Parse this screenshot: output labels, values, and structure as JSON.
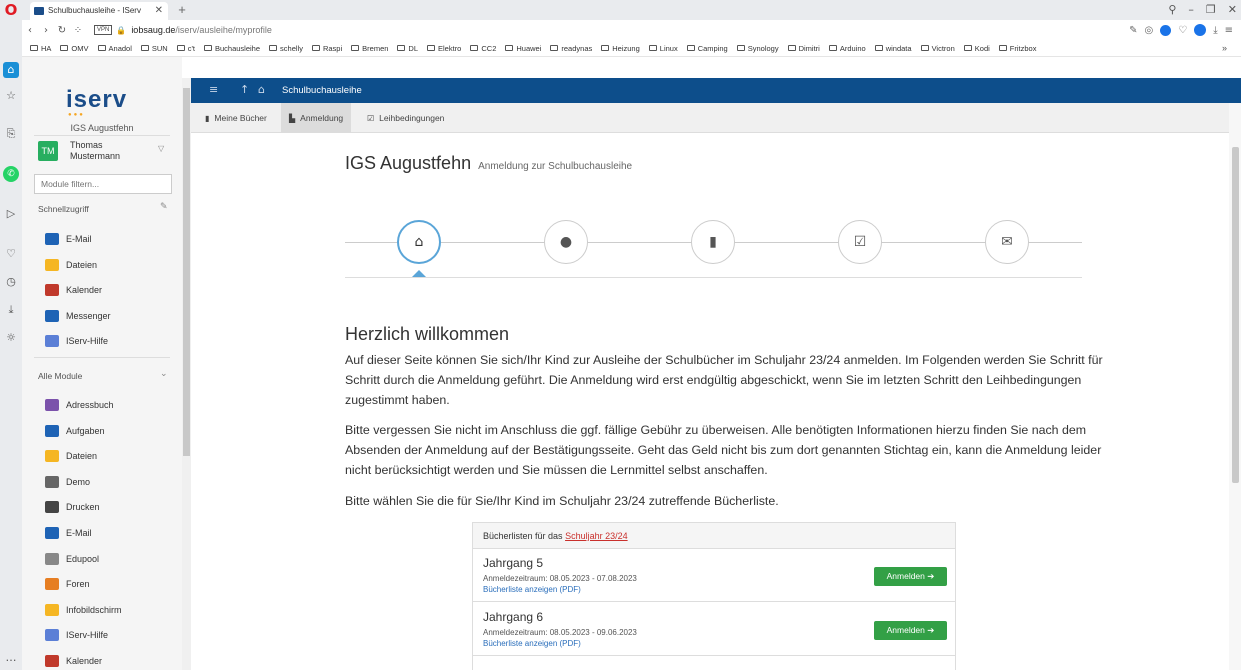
{
  "browser": {
    "tab_title": "Schulbuchausleihe - IServ",
    "url_host": "iobsaug.de",
    "url_path": "/iserv/ausleihe/myprofile",
    "vpn": "VPN",
    "bookmarks": [
      "HA",
      "OMV",
      "Anadol",
      "SUN",
      "c't",
      "Buchausleihe",
      "schelly",
      "Raspi",
      "Bremen",
      "DL",
      "Elektro",
      "CC2",
      "Huawei",
      "readynas",
      "Heizung",
      "Linux",
      "Camping",
      "Synology",
      "Dimitri",
      "Arduino",
      "windata",
      "Victron",
      "Kodi",
      "Fritzbox"
    ]
  },
  "sidebar": {
    "logo": "iserv",
    "school": "IGS Augustfehn",
    "user_initials": "TM",
    "user_name": "Thomas Mustermann",
    "filter_placeholder": "Module filtern...",
    "quick_label": "Schnellzugriff",
    "quick_items": [
      {
        "label": "E-Mail",
        "color": "#1e63b5",
        "icon": "mail-icon"
      },
      {
        "label": "Dateien",
        "color": "#f5b623",
        "icon": "folder-icon"
      },
      {
        "label": "Kalender",
        "color": "#c0392b",
        "icon": "calendar-icon"
      },
      {
        "label": "Messenger",
        "color": "#1e63b5",
        "icon": "chat-icon"
      },
      {
        "label": "IServ-Hilfe",
        "color": "#5b7fd6",
        "icon": "help-icon"
      }
    ],
    "all_label": "Alle Module",
    "all_items": [
      {
        "label": "Adressbuch",
        "color": "#7b52ab",
        "icon": "addressbook-icon"
      },
      {
        "label": "Aufgaben",
        "color": "#1e63b5",
        "icon": "tasks-icon"
      },
      {
        "label": "Dateien",
        "color": "#f5b623",
        "icon": "folder-icon"
      },
      {
        "label": "Demo",
        "color": "#666666",
        "icon": "demo-icon"
      },
      {
        "label": "Drucken",
        "color": "#444444",
        "icon": "printer-icon"
      },
      {
        "label": "E-Mail",
        "color": "#1e63b5",
        "icon": "mail-icon"
      },
      {
        "label": "Edupool",
        "color": "#888888",
        "icon": "edupool-icon"
      },
      {
        "label": "Foren",
        "color": "#e67e22",
        "icon": "forum-icon"
      },
      {
        "label": "Infobildschirm",
        "color": "#f5b623",
        "icon": "screen-icon"
      },
      {
        "label": "IServ-Hilfe",
        "color": "#5b7fd6",
        "icon": "help-icon"
      },
      {
        "label": "Kalender",
        "color": "#c0392b",
        "icon": "calendar-icon"
      }
    ]
  },
  "header": {
    "title": "Schulbuchausleihe"
  },
  "subnav": {
    "tabs": [
      "Meine Bücher",
      "Anmeldung",
      "Leihbedingungen"
    ]
  },
  "main": {
    "title": "IGS Augustfehn",
    "subtitle": "Anmeldung zur Schulbuchausleihe",
    "wizard_active_step": 1,
    "welcome": "Herzlich willkommen",
    "para1": "Auf dieser Seite können Sie sich/Ihr Kind zur Ausleihe der Schulbücher im Schuljahr 23/24 anmelden. Im Folgenden werden Sie Schritt für Schritt durch die Anmeldung geführt. Die Anmeldung wird erst endgültig abgeschickt, wenn Sie im letzten Schritt den Leihbedingungen zugestimmt haben.",
    "para2": "Bitte vergessen Sie nicht im Anschluss die ggf. fällige Gebühr zu überweisen. Alle benötigten Informationen hierzu finden Sie nach dem Absenden der Anmeldung auf der Bestätigungsseite. Geht das Geld nicht bis zum dort genannten Stichtag ein, kann die Anmeldung leider nicht berücksichtigt werden und Sie müssen die Lernmittel selbst anschaffen.",
    "para3": "Bitte wählen Sie die für Sie/Ihr Kind im Schuljahr 23/24 zutreffende Bücherliste.",
    "booklist": {
      "head_prefix": "Bücherlisten für das",
      "head_link": "Schuljahr 23/24",
      "rows": [
        {
          "year": "Jahrgang 5",
          "period": "Anmeldezeitraum: 08.05.2023 - 07.08.2023",
          "link": "Bücherliste anzeigen (PDF)",
          "button": "Anmelden ➔"
        },
        {
          "year": "Jahrgang 6",
          "period": "Anmeldezeitraum: 08.05.2023 - 09.06.2023",
          "link": "Bücherliste anzeigen (PDF)",
          "button": "Anmelden ➔"
        }
      ]
    }
  }
}
